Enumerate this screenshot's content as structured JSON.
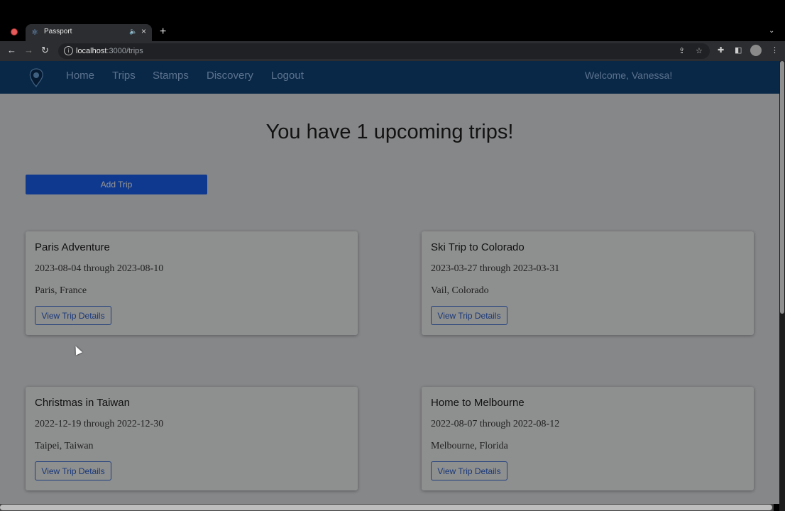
{
  "browser": {
    "tab_title": "Passport",
    "url_host": "localhost",
    "url_path": ":3000/trips",
    "new_tab_icon": "plus-icon"
  },
  "navbar": {
    "logo_icon": "passport-logo",
    "links": [
      "Home",
      "Trips",
      "Stamps",
      "Discovery",
      "Logout"
    ],
    "welcome": "Welcome, Vanessa!",
    "background": "#11457a"
  },
  "main": {
    "heading": "You have 1 upcoming trips!",
    "add_trip_label": "Add Trip",
    "add_trip_color": "#1b62f5",
    "trips": [
      {
        "title": "Paris Adventure",
        "dates": "2023-08-04 through 2023-08-10",
        "location": "Paris, France",
        "button": "View Trip Details"
      },
      {
        "title": "Ski Trip to Colorado",
        "dates": "2023-03-27 through 2023-03-31",
        "location": "Vail, Colorado",
        "button": "View Trip Details"
      },
      {
        "title": "Christmas in Taiwan",
        "dates": "2022-12-19 through 2022-12-30",
        "location": "Taipei, Taiwan",
        "button": "View Trip Details"
      },
      {
        "title": "Home to Melbourne",
        "dates": "2022-08-07 through 2022-08-12",
        "location": "Melbourne, Florida",
        "button": "View Trip Details"
      }
    ]
  }
}
